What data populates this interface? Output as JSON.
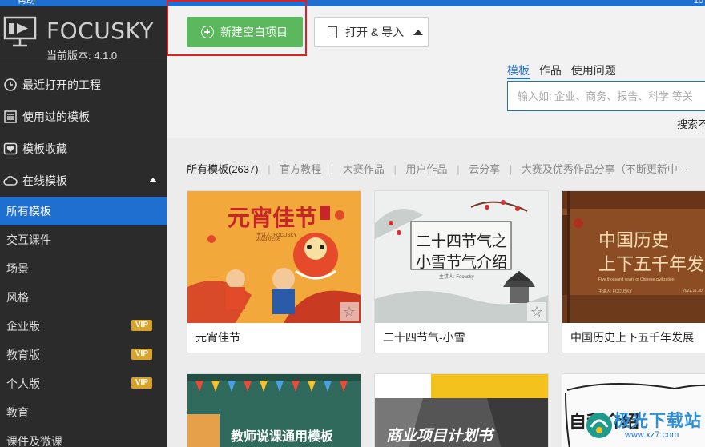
{
  "topbar": {
    "menu_label": "帮助",
    "right_text": "10"
  },
  "brand": {
    "name": "FOCUSKY",
    "version": "当前版本: 4.1.0"
  },
  "sidebar": {
    "items": [
      {
        "label": "最近打开的工程",
        "icon": "clock-icon"
      },
      {
        "label": "使用过的模板",
        "icon": "list-icon"
      },
      {
        "label": "模板收藏",
        "icon": "heart-icon"
      }
    ],
    "section": {
      "label": "在线模板",
      "icon": "cloud-icon"
    },
    "sub_items": [
      {
        "label": "所有模板",
        "active": true,
        "vip": false
      },
      {
        "label": "交互课件",
        "vip": false
      },
      {
        "label": "场景",
        "vip": false
      },
      {
        "label": "风格",
        "vip": false
      },
      {
        "label": "企业版",
        "vip": true
      },
      {
        "label": "教育版",
        "vip": true
      },
      {
        "label": "个人版",
        "vip": true
      },
      {
        "label": "教育",
        "vip": false
      },
      {
        "label": "课件及微课",
        "vip": false
      }
    ],
    "vip_label": "VIP"
  },
  "toolbar": {
    "new_label": "新建空白项目",
    "open_label": "打开 & 导入"
  },
  "search": {
    "tabs": [
      "模板",
      "作品",
      "使用问题"
    ],
    "placeholder": "输入如: 企业、商务、报告、科学 等关",
    "button_label": "搜索不"
  },
  "filters": {
    "all": "所有模板(2637)",
    "items": [
      "官方教程",
      "大赛作品",
      "用户作品",
      "云分享",
      "大赛及优秀作品分享（不断更新中···"
    ]
  },
  "templates": [
    {
      "name": "元宵佳节",
      "thumb_title": "元宵佳节",
      "thumb_sub": "主讲人: FOCUSKY",
      "thumb_date": "2023.02.05"
    },
    {
      "name": "二十四节气-小雪",
      "thumb_title_1": "二十四节气之",
      "thumb_title_2": "小雪节气介绍",
      "thumb_sub": "主讲人: Focusky"
    },
    {
      "name": "中国历史上下五千年发展",
      "thumb_title_1": "中国历史",
      "thumb_title_2": "上下五千年发",
      "thumb_sub": "Five thousand years of Chinese civilization",
      "thumb_presenter": "主讲人: FOCUSKY",
      "thumb_date": "2022.11.30"
    }
  ],
  "templates_row2": [
    {
      "thumb_title": "教师说课通用模板"
    },
    {
      "thumb_title": "商业项目计划书"
    },
    {
      "thumb_title": "自我介绍"
    }
  ],
  "watermark": {
    "text": "极光下载站",
    "url": "www.xz7.com"
  },
  "colors": {
    "accent": "#1f6fd0",
    "green": "#5cb85c",
    "sidebar_bg": "#2b2b2b",
    "vip": "#d7a32c",
    "highlight": "#e02020"
  }
}
